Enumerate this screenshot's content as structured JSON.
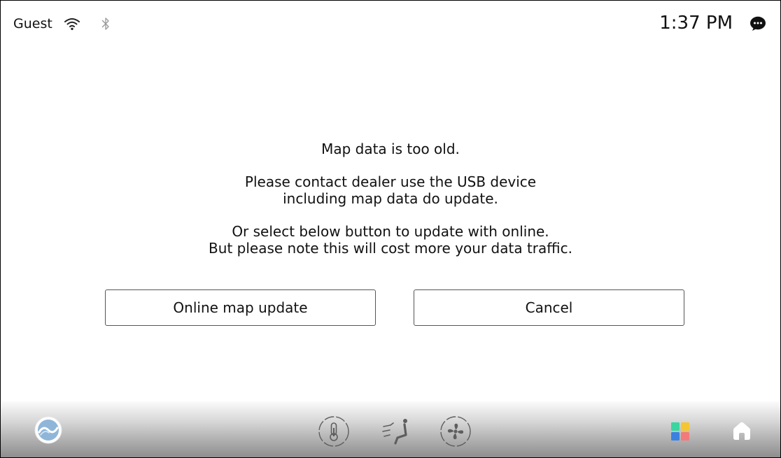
{
  "status_bar": {
    "user": "Guest",
    "time": "1:37 PM",
    "icons": [
      "wifi-icon",
      "bluetooth-icon",
      "chat-bubble-icon"
    ]
  },
  "dialog": {
    "line1": "Map data is too old.",
    "line2": "Please contact dealer use the USB device",
    "line3": "including map data do update.",
    "line4": "Or select below button to update with online.",
    "line5": "But please note this will cost more your data traffic.",
    "update_button": "Online map update",
    "cancel_button": "Cancel"
  },
  "bottom_bar": {
    "icons": [
      "navigation-globe-icon",
      "temperature-icon",
      "seat-airflow-icon",
      "fan-icon",
      "apps-grid-icon",
      "home-icon"
    ],
    "app_grid_colors": [
      "#3ad6a0",
      "#f5c633",
      "#3b82e0",
      "#f27a7a"
    ]
  }
}
